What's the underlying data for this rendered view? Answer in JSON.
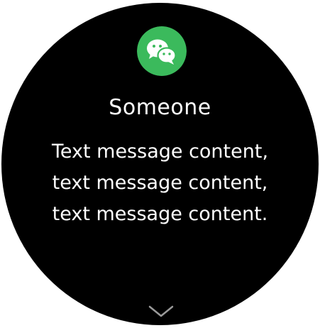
{
  "notification": {
    "app_icon": "wechat-icon",
    "app_icon_color": "#3bba5c",
    "sender": "Someone",
    "message_lines": [
      "Text message content,",
      "text message content,",
      "text message content."
    ],
    "more_icon": "chevron-down-icon"
  }
}
